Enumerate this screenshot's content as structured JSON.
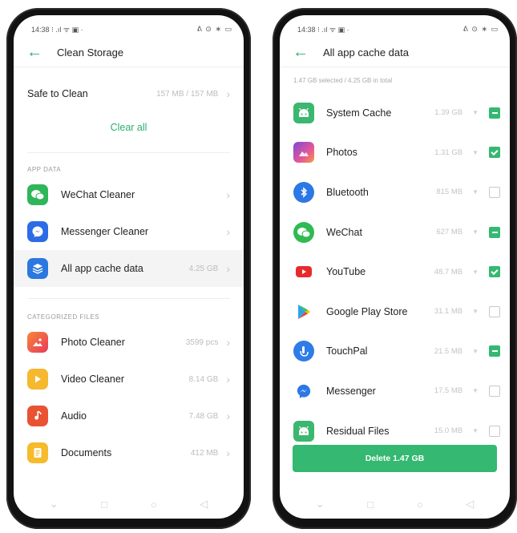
{
  "colors": {
    "accent": "#2aaf6b"
  },
  "left": {
    "status": {
      "time": "14:38",
      "left_icons": "⁝ .ıl ᯤ ▣ ·",
      "right_icons": "ᕕ ⊙ ∗ ▭"
    },
    "header": {
      "title": "Clean Storage"
    },
    "safe_row": {
      "label": "Safe to Clean",
      "value": "157 MB / 157 MB"
    },
    "clear_all": "Clear all",
    "app_data_label": "APP DATA",
    "app_items": [
      {
        "label": "WeChat Cleaner",
        "value": "",
        "icon": "wechat-icon",
        "color": "#2fb55a"
      },
      {
        "label": "Messenger Cleaner",
        "value": "",
        "icon": "messenger-icon",
        "color": "#2c6ce6"
      },
      {
        "label": "All app cache data",
        "value": "4.25 GB",
        "icon": "layers-icon",
        "color": "#2a78e0"
      }
    ],
    "categorized_label": "CATEGORIZED FILES",
    "file_items": [
      {
        "label": "Photo Cleaner",
        "value": "3599 pcs",
        "icon": "photo-icon",
        "color": "#ef5a3a"
      },
      {
        "label": "Video Cleaner",
        "value": "8.14 GB",
        "icon": "play-icon",
        "color": "#f5b82e"
      },
      {
        "label": "Audio",
        "value": "7.48 GB",
        "icon": "music-icon",
        "color": "#ea5234"
      },
      {
        "label": "Documents",
        "value": "412 MB",
        "icon": "document-icon",
        "color": "#f5bb2b"
      }
    ]
  },
  "right": {
    "status": {
      "time": "14:38",
      "left_icons": "⁝ .ıl ᯤ ▣ ·",
      "right_icons": "ᕕ ⊙ ∗ ▭"
    },
    "header": {
      "title": "All app cache data"
    },
    "summary": "1.47 GB selected / 4.25 GB in total",
    "apps": [
      {
        "label": "System Cache",
        "size": "1.39 GB",
        "state": "partial",
        "icon": "android-icon",
        "color": "#3bb76f"
      },
      {
        "label": "Photos",
        "size": "1.31 GB",
        "state": "checked",
        "icon": "photos-icon",
        "color": "#e0558c"
      },
      {
        "label": "Bluetooth",
        "size": "815 MB",
        "state": "unchecked",
        "icon": "bluetooth-icon",
        "color": "#2c78e4"
      },
      {
        "label": "WeChat",
        "size": "627 MB",
        "state": "partial",
        "icon": "wechat-icon",
        "color": "#2fba52"
      },
      {
        "label": "YouTube",
        "size": "48.7 MB",
        "state": "checked",
        "icon": "youtube-icon",
        "color": "#e82a2a"
      },
      {
        "label": "Google Play Store",
        "size": "31.1 MB",
        "state": "unchecked",
        "icon": "play-store-icon",
        "color": "#ffffff"
      },
      {
        "label": "TouchPal",
        "size": "21.5 MB",
        "state": "partial",
        "icon": "touchpal-icon",
        "color": "#2f7be8"
      },
      {
        "label": "Messenger",
        "size": "17.5 MB",
        "state": "unchecked",
        "icon": "messenger-icon",
        "color": "#ffffff"
      },
      {
        "label": "Residual Files",
        "size": "15.0 MB",
        "state": "unchecked",
        "icon": "android-icon",
        "color": "#3bb76f"
      }
    ],
    "delete_label": "Delete 1.47 GB"
  }
}
